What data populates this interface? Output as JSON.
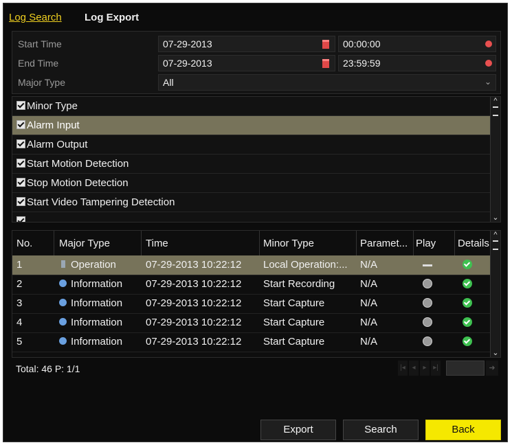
{
  "tabs": [
    {
      "label": "Log Search",
      "active": true
    },
    {
      "label": "Log Export",
      "active": false
    }
  ],
  "filters": {
    "start_time": {
      "label": "Start Time",
      "date": "07-29-2013",
      "time": "00:00:00"
    },
    "end_time": {
      "label": "End Time",
      "date": "07-29-2013",
      "time": "23:59:59"
    },
    "major_type": {
      "label": "Major Type",
      "value": "All"
    }
  },
  "minor_types": [
    {
      "label": "Minor Type",
      "checked": true
    },
    {
      "label": "Alarm Input",
      "checked": true,
      "highlighted": true
    },
    {
      "label": "Alarm Output",
      "checked": true
    },
    {
      "label": "Start Motion Detection",
      "checked": true
    },
    {
      "label": "Stop Motion Detection",
      "checked": true
    },
    {
      "label": "Start Video Tampering Detection",
      "checked": true
    }
  ],
  "table": {
    "headers": {
      "no": "No.",
      "major": "Major Type",
      "time": "Time",
      "minor": "Minor Type",
      "param": "Paramet...",
      "play": "Play",
      "details": "Details"
    },
    "rows": [
      {
        "no": "1",
        "major": "Operation",
        "time": "07-29-2013 10:22:12",
        "minor": "Local Operation:...",
        "param": "N/A"
      },
      {
        "no": "2",
        "major": "Information",
        "time": "07-29-2013 10:22:12",
        "minor": "Start Recording",
        "param": "N/A"
      },
      {
        "no": "3",
        "major": "Information",
        "time": "07-29-2013 10:22:12",
        "minor": "Start Capture",
        "param": "N/A"
      },
      {
        "no": "4",
        "major": "Information",
        "time": "07-29-2013 10:22:12",
        "minor": "Start Capture",
        "param": "N/A"
      },
      {
        "no": "5",
        "major": "Information",
        "time": "07-29-2013 10:22:12",
        "minor": "Start Capture",
        "param": "N/A"
      }
    ]
  },
  "footer": {
    "total": "Total: 46  P: 1/1"
  },
  "buttons": {
    "export": "Export",
    "search": "Search",
    "back": "Back"
  },
  "colors": {
    "highlight": "#77735a",
    "accent": "#f5e800",
    "tab_active": "#f0d020"
  }
}
